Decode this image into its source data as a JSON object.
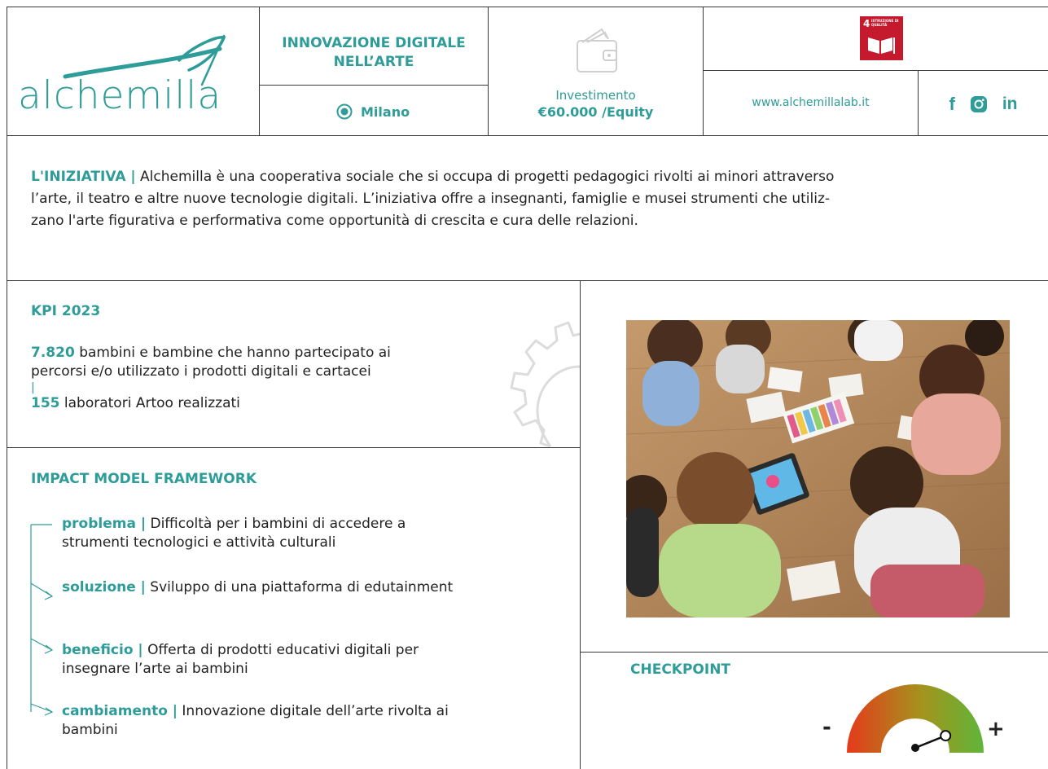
{
  "header": {
    "logo_text": "alchemilla",
    "title": "INNOVAZIONE DIGITALE NELL’ARTE",
    "city": "Milano",
    "investment_label": "Investimento",
    "investment_value": "€60.000 /Equity",
    "sdg_badge": {
      "number": "4",
      "label": "ISTRUZIONE DI QUALITÀ",
      "color": "#c5192d"
    },
    "website": "www.alchemillalab.it",
    "social": [
      "facebook-icon",
      "instagram-icon",
      "linkedin-icon"
    ]
  },
  "initiative": {
    "label": "L'INIZIATIVA |",
    "lines": [
      "Alchemilla è una cooperativa sociale che si occupa di progetti pedagogici rivolti ai minori attraverso",
      "l’arte, il teatro e altre nuove tecnologie digitali. L’iniziativa offre a insegnanti, famiglie e musei strumenti che utiliz-",
      "zano l'arte figurativa e performativa come opportunità di crescita e cura delle relazioni."
    ]
  },
  "kpi": {
    "title": "KPI 2023",
    "item1_value": "7.820",
    "item1_line1": "bambini e bambine che hanno partecipato ai",
    "item1_line2": "percorsi e/o utilizzato i prodotti digitali e cartacei",
    "separator": "|",
    "item2_value": "155",
    "item2_text": "laboratori Artoo realizzati"
  },
  "impact": {
    "title": "IMPACT MODEL FRAMEWORK",
    "items": [
      {
        "label": "problema |",
        "line1": "Difficoltà per i bambini di accedere a",
        "line2": "strumenti tecnologici e attività culturali"
      },
      {
        "label": "soluzione |",
        "line1": "Sviluppo di una piattaforma di edutainment",
        "line2": ""
      },
      {
        "label": "beneficio |",
        "line1": "Offerta di prodotti educativi digitali per",
        "line2": "insegnare l’arte ai bambini"
      },
      {
        "label": "cambiamento |",
        "line1": "Innovazione digitale dell’arte rivolta ai",
        "line2": "bambini"
      }
    ]
  },
  "checkpoint": {
    "title": "CHECKPOINT",
    "minus": "-",
    "plus": "+",
    "level": 0.8
  },
  "colors": {
    "accent": "#2e9c98",
    "sdg_red": "#c5192d",
    "gauge_low": "#e53a1c",
    "gauge_high": "#5fb53a"
  }
}
